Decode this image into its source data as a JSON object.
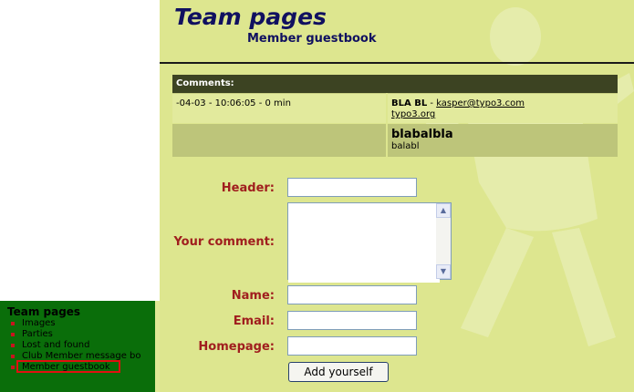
{
  "sidebar": {
    "title": "Team pages",
    "items": [
      {
        "label": "Images"
      },
      {
        "label": "Parties"
      },
      {
        "label": "Lost and found"
      },
      {
        "label": "Club Member message bo"
      },
      {
        "label": "Member guestbook",
        "active": true
      }
    ]
  },
  "header": {
    "title": "Team pages",
    "subtitle": "Member guestbook"
  },
  "comments": {
    "heading": "Comments:",
    "entry": {
      "datetime": "-04-03 - 10:06:05 - 0 min",
      "author": "BLA BL",
      "separator": " - ",
      "email": "kasper@typo3.com",
      "homepage": "typo3.org",
      "title": "blabalbla",
      "text": "balabl"
    }
  },
  "form": {
    "header_label": "Header:",
    "header_value": "",
    "comment_label": "Your comment:",
    "comment_value": "",
    "name_label": "Name:",
    "name_value": "",
    "email_label": "Email:",
    "email_value": "",
    "homepage_label": "Homepage:",
    "homepage_value": "",
    "submit_label": "Add yourself"
  },
  "colors": {
    "sidebar_bg": "#0a6e0a",
    "content_bg": "#dde68f",
    "title_color": "#101060",
    "label_color": "#a01e1e",
    "comments_header_bg": "#3c4322"
  }
}
